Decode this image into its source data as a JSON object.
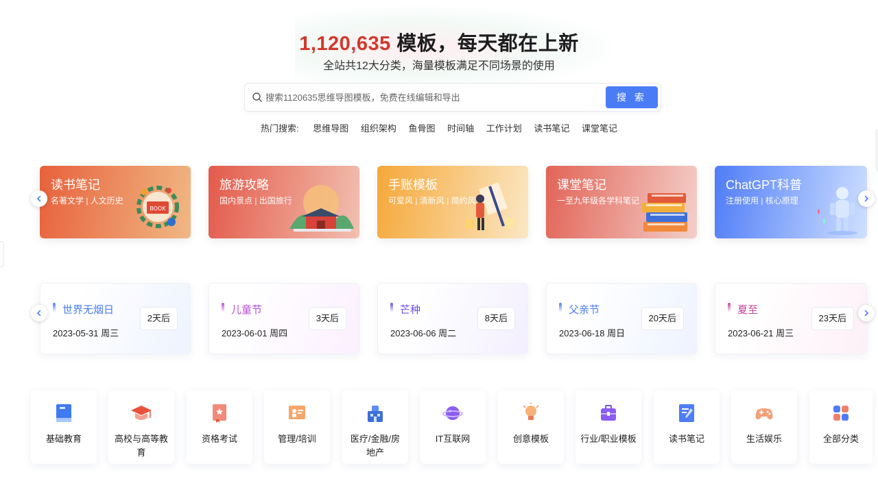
{
  "hero": {
    "count": "1,120,635",
    "title_rest": " 模板，每天都在上新",
    "subtitle": "全站共12大分类，海量模板满足不同场景的使用"
  },
  "search": {
    "placeholder": "搜索1120635思维导图模板，免费在线编辑和导出",
    "button_label": "搜 索"
  },
  "hot": {
    "label": "热门搜索:",
    "items": [
      "思维导图",
      "组织架构",
      "鱼骨图",
      "时间轴",
      "工作计划",
      "读书笔记",
      "课堂笔记"
    ]
  },
  "banners": [
    {
      "title": "读书笔记",
      "subtitle": "名著文学 | 人文历史",
      "colors": [
        "#e8613c",
        "#f0b884"
      ],
      "icon": "book-wreath-icon"
    },
    {
      "title": "旅游攻略",
      "subtitle": "国内景点 | 出国旅行",
      "colors": [
        "#e35a4a",
        "#f2c0b0"
      ],
      "icon": "palace-icon"
    },
    {
      "title": "手账模板",
      "subtitle": "可爱风 | 清新风 | 简约风",
      "colors": [
        "#f5a83a",
        "#fbe7c4"
      ],
      "icon": "person-board-icon"
    },
    {
      "title": "课堂笔记",
      "subtitle": "一至九年级各学科笔记",
      "colors": [
        "#e26457",
        "#f3cfc9"
      ],
      "icon": "book-stack-icon"
    },
    {
      "title": "ChatGPT科普",
      "subtitle": "注册使用 | 核心原理",
      "colors": [
        "#4f7cf7",
        "#cfe0ff"
      ],
      "icon": "robot-icon"
    }
  ],
  "events": [
    {
      "name": "世界无烟日",
      "date": "2023-05-31 周三",
      "countdown": "2天后",
      "color": "#4a7cf6",
      "bg": "#eef3ff"
    },
    {
      "name": "儿童节",
      "date": "2023-06-01 周四",
      "countdown": "3天后",
      "color": "#b84dd6",
      "bg": "#fbf0ff"
    },
    {
      "name": "芒种",
      "date": "2023-06-06 周二",
      "countdown": "8天后",
      "color": "#6a4fe0",
      "bg": "#f3efff"
    },
    {
      "name": "父亲节",
      "date": "2023-06-18 周日",
      "countdown": "20天后",
      "color": "#4a7cf6",
      "bg": "#eef3ff"
    },
    {
      "name": "夏至",
      "date": "2023-06-21 周三",
      "countdown": "23天后",
      "color": "#c2449a",
      "bg": "#fdf0f7"
    }
  ],
  "categories": [
    {
      "label": "基础教育",
      "icon": "book-icon"
    },
    {
      "label": "高校与高等教育",
      "icon": "graduation-cap-icon"
    },
    {
      "label": "资格考试",
      "icon": "certificate-icon"
    },
    {
      "label": "管理/培训",
      "icon": "presentation-board-icon"
    },
    {
      "label": "医疗/金融/房地产",
      "icon": "building-icon"
    },
    {
      "label": "IT互联网",
      "icon": "planet-icon"
    },
    {
      "label": "创意模板",
      "icon": "lightbulb-icon"
    },
    {
      "label": "行业/职业模板",
      "icon": "briefcase-icon"
    },
    {
      "label": "读书笔记",
      "icon": "notebook-pen-icon"
    },
    {
      "label": "生活娱乐",
      "icon": "gamepad-icon"
    },
    {
      "label": "全部分类",
      "icon": "grid-apps-icon"
    }
  ]
}
